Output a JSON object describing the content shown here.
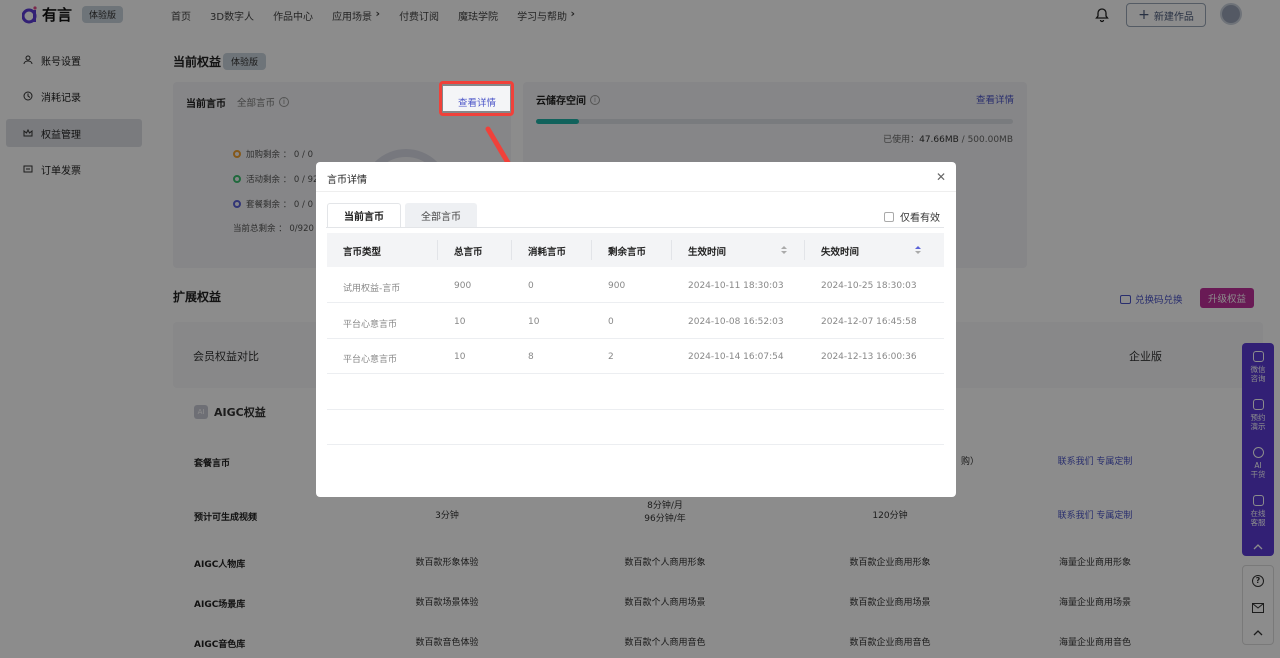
{
  "topbar": {
    "logo_text": "有言",
    "edition_badge": "体验版",
    "nav": [
      "首页",
      "3D数字人",
      "作品中心",
      "应用场景",
      "付费订阅",
      "魔珐学院",
      "学习与帮助"
    ],
    "new_button": "新建作品"
  },
  "sidebar": {
    "items": [
      {
        "label": "账号设置",
        "icon": "user-icon"
      },
      {
        "label": "消耗记录",
        "icon": "clock-icon"
      },
      {
        "label": "权益管理",
        "icon": "crown-icon"
      },
      {
        "label": "订单发票",
        "icon": "invoice-icon"
      }
    ]
  },
  "rights": {
    "title": "当前权益",
    "badge": "体验版",
    "coin_card": {
      "title": "当前言币",
      "subtitle": "全部言币",
      "view_detail": "查看详情",
      "legend": [
        {
          "label": "加购剩余 ： 0 / 0",
          "color": "#f0a030"
        },
        {
          "label": "活动剩余 ： 0 / 920",
          "color": "#3cc070"
        },
        {
          "label": "套餐剩余 ： 0 / 0",
          "color": "#5b62d8"
        }
      ],
      "total": "当前总剩余 ： 0/920"
    },
    "storage_card": {
      "title": "云储存空间",
      "view_detail": "查看详情",
      "used_label": "已使用：",
      "used_value": "47.66MB",
      "total_value": " / 500.00MB",
      "fill_fraction": 0.09
    }
  },
  "extended": {
    "title": "扩展权益",
    "redeem_button": "兑换码兑换",
    "upgrade_button": "升级权益",
    "compare_label": "会员权益对比",
    "enterprise_label": "企业版",
    "aigc_label": "AIGC权益",
    "rows": [
      {
        "label": "套餐言币",
        "cells": [
          "",
          "",
          "购）",
          "联系我们 专属定制"
        ]
      },
      {
        "label": "预计可生成视频",
        "cells": [
          "3分钟",
          "8分钟/月\n96分钟/年",
          "120分钟",
          "联系我们 专属定制"
        ]
      },
      {
        "label": "AIGC人物库",
        "cells": [
          "数百款形象体验",
          "数百款个人商用形象",
          "数百款企业商用形象",
          "海量企业商用形象"
        ]
      },
      {
        "label": "AIGC场景库",
        "cells": [
          "数百款场景体验",
          "数百款个人商用场景",
          "数百款企业商用场景",
          "海量企业商用场景"
        ]
      },
      {
        "label": "AIGC音色库",
        "cells": [
          "数百款音色体验",
          "数百款个人商用音色",
          "数百款企业商用音色",
          "海量企业商用音色"
        ]
      }
    ]
  },
  "modal": {
    "title": "言币详情",
    "tabs": [
      "当前言币",
      "全部言币"
    ],
    "only_valid": "仅看有效",
    "columns": [
      "言币类型",
      "总言币",
      "消耗言币",
      "剩余言币",
      "生效时间",
      "失效时间"
    ],
    "rows": [
      [
        "试用权益-言币",
        "900",
        "0",
        "900",
        "2024-10-11 18:30:03",
        "2024-10-25 18:30:03"
      ],
      [
        "平台心意言币",
        "10",
        "10",
        "0",
        "2024-10-08 16:52:03",
        "2024-12-07 16:45:58"
      ],
      [
        "平台心意言币",
        "10",
        "8",
        "2",
        "2024-10-14 16:07:54",
        "2024-12-13 16:00:36"
      ]
    ]
  },
  "float_panel": {
    "items": [
      "微信\n咨询",
      "预约\n演示",
      "AI\n干货",
      "在线\n客服"
    ]
  }
}
